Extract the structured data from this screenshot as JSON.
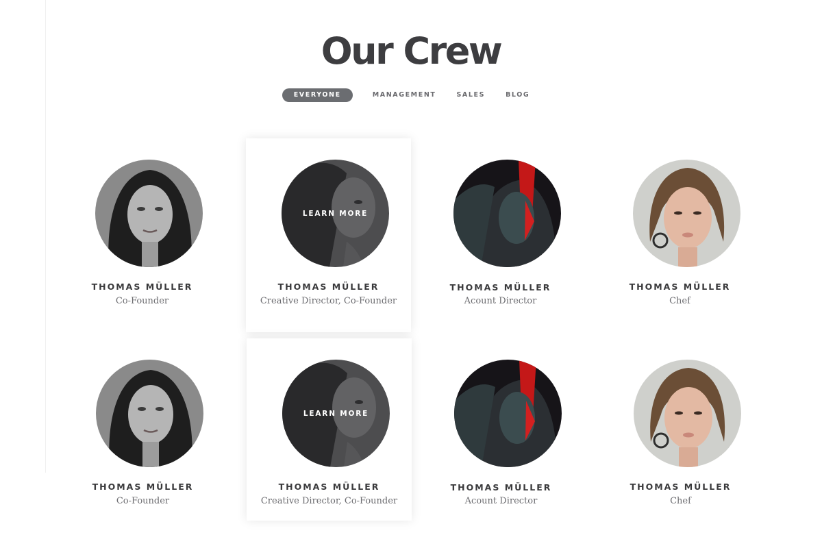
{
  "page": {
    "title": "Our Crew"
  },
  "filters": [
    {
      "label": "EVERYONE",
      "active": true
    },
    {
      "label": "MANAGEMENT",
      "active": false
    },
    {
      "label": "SALES",
      "active": false
    },
    {
      "label": "BLOG",
      "active": false
    }
  ],
  "overlay_label": "LEARN MORE",
  "members": [
    {
      "name": "THOMAS MÜLLER",
      "role": "Co-Founder"
    },
    {
      "name": "THOMAS MÜLLER",
      "role": "Creative Director, Co-Founder"
    },
    {
      "name": "THOMAS MÜLLER",
      "role": "Acount Director"
    },
    {
      "name": "THOMAS MÜLLER",
      "role": "Chef"
    },
    {
      "name": "THOMAS MÜLLER",
      "role": "Co-Founder"
    },
    {
      "name": "THOMAS MÜLLER",
      "role": "Creative Director, Co-Founder"
    },
    {
      "name": "THOMAS MÜLLER",
      "role": "Acount Director"
    },
    {
      "name": "THOMAS MÜLLER",
      "role": "Chef"
    }
  ],
  "colors": {
    "title": "#3d3d40",
    "active_filter_bg": "#6b6d71",
    "text_muted": "#6c6c70"
  }
}
